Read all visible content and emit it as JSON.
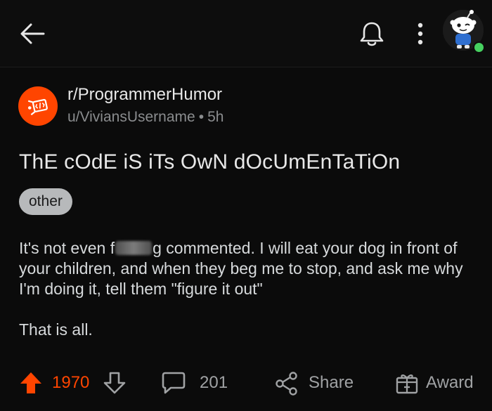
{
  "topbar": {
    "icons": [
      "back-arrow-icon",
      "bell-icon",
      "more-vertical-icon"
    ],
    "avatar_status": "online"
  },
  "post": {
    "subreddit": "r/ProgrammerHumor",
    "author": "u/ViviansUsername",
    "separator": "•",
    "age": "5h",
    "title": "ThE cOdE iS iTs OwN dOcUmEnTaTiOn",
    "flair": "other",
    "body_line1_pre": "It's not even f",
    "body_line1_post": "g commented. I will eat your dog in front of your children, and when they beg me to stop, and ask me why I'm doing it, tell them \"figure it out\"",
    "body_line2": "That is all."
  },
  "actions": {
    "upvotes": "1970",
    "comments": "201",
    "share_label": "Share",
    "award_label": "Award"
  },
  "colors": {
    "accent": "#ff4500",
    "background": "#0b0b0b",
    "text": "#d7dadc",
    "muted": "#8a8c8e",
    "online": "#46d160"
  }
}
